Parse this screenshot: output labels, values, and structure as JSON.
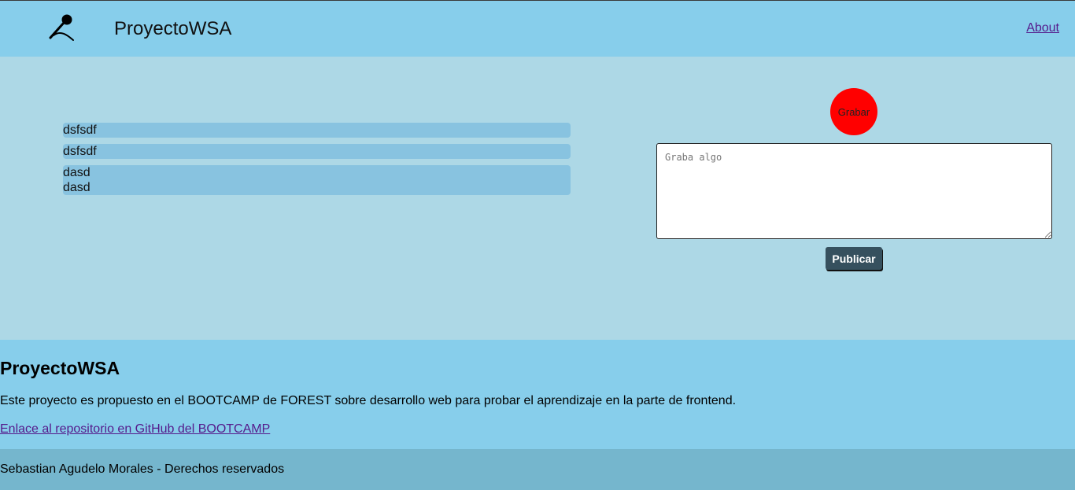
{
  "header": {
    "logo_icon": "microphone-icon",
    "brand": "ProyectoWSA",
    "about_label": "About"
  },
  "posts": [
    {
      "text": "dsfsdf"
    },
    {
      "text": "dsfsdf"
    },
    {
      "text": "dasd\ndasd"
    }
  ],
  "recorder": {
    "record_label": "Grabar",
    "record_color": "#ff0000",
    "textarea_placeholder": "Graba algo",
    "textarea_value": "",
    "publish_label": "Publicar"
  },
  "info": {
    "title": "ProyectoWSA",
    "description": "Este proyecto es propuesto en el BOOTCAMP de FOREST sobre desarrollo web para probar el aprendizaje en la parte de frontend.",
    "repo_link_label": "Enlace al repositorio en GitHub del BOOTCAMP"
  },
  "footer": {
    "text": "Sebastian Agudelo Morales - Derechos reservados"
  },
  "colors": {
    "header_bg": "#87ceeb",
    "main_bg": "#add8e6",
    "post_bg": "#88c3e0",
    "footer_bg": "#75b6cd",
    "publish_bg": "#36505e",
    "link": "#551a8b"
  }
}
